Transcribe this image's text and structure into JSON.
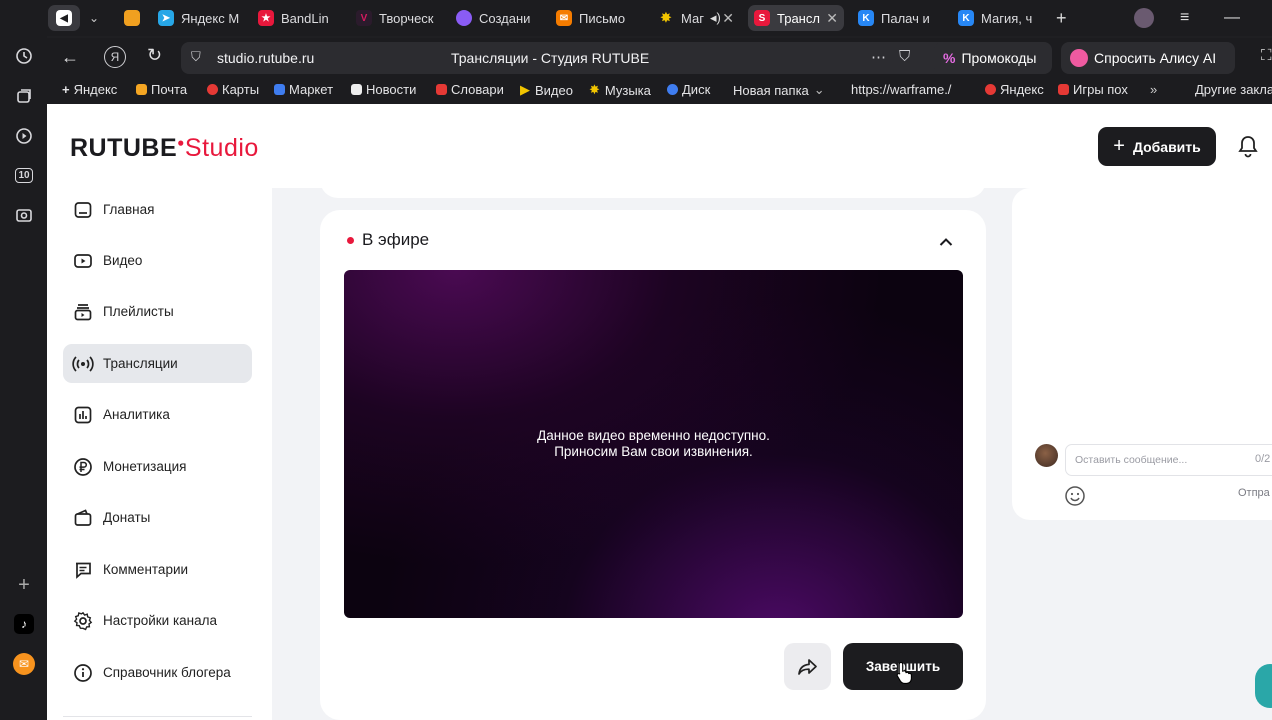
{
  "browser": {
    "tabs": [
      {
        "label": "",
        "icon": "yandex-browser-icon",
        "color": "#7a5cc8"
      },
      {
        "label": "",
        "icon": "tab-sound-icon",
        "color": "#ffffff"
      },
      {
        "label": "",
        "icon": "pinned-tab-icon",
        "color": "#f0a020"
      },
      {
        "label": "Яндекс М",
        "icon": "telegram-icon",
        "color": "#27a7e7"
      },
      {
        "label": "BandLin",
        "icon": "bandlink-icon",
        "color": "#e8183c"
      },
      {
        "label": "Творческ",
        "icon": "vk-studio-icon",
        "color": "#d81b60"
      },
      {
        "label": "Создани",
        "icon": "alice-icon",
        "color": "#8a5cf5"
      },
      {
        "label": "Письмо",
        "icon": "mail-icon",
        "color": "#f57c00"
      },
      {
        "label": "Маг",
        "icon": "star-icon",
        "color": "#f2c500"
      },
      {
        "label": "Трансл",
        "icon": "rutube-icon",
        "color": "#e8183c"
      },
      {
        "label": "Палач и",
        "icon": "vk-icon",
        "color": "#2787f5"
      },
      {
        "label": "Магия, ч",
        "icon": "vk-icon",
        "color": "#2787f5"
      }
    ],
    "url": "studio.rutube.ru",
    "page_title": "Трансляции - Студия RUTUBE",
    "promo_label": "Промокоды",
    "alice_label": "Спросить Алису AI",
    "bookmarks": [
      {
        "label": "Яндекс",
        "color": "#1c1c1f"
      },
      {
        "label": "Почта",
        "color": "#f5a623"
      },
      {
        "label": "Карты",
        "color": "#e53935"
      },
      {
        "label": "Маркет",
        "color": "#3f7df0"
      },
      {
        "label": "Новости",
        "color": "#eeeeee"
      },
      {
        "label": "Словари",
        "color": "#e53935"
      },
      {
        "label": "Видео",
        "color": "#f2c500"
      },
      {
        "label": "Музыка",
        "color": "#f2c500"
      },
      {
        "label": "Диск",
        "color": "#3f7df0"
      },
      {
        "label": "Новая папка",
        "color": ""
      },
      {
        "label": "https://warframe./",
        "color": ""
      },
      {
        "label": "Яндекс",
        "color": "#e53935"
      },
      {
        "label": "Игры пох",
        "color": "#e53935"
      },
      {
        "label": "Другие закла",
        "color": ""
      }
    ]
  },
  "header": {
    "logo_main": "RUTUBE",
    "logo_studio": "Studio",
    "add_button": "Добавить"
  },
  "sidebar": {
    "items": [
      {
        "label": "Главная",
        "icon": "home-icon"
      },
      {
        "label": "Видео",
        "icon": "video-icon"
      },
      {
        "label": "Плейлисты",
        "icon": "playlist-icon"
      },
      {
        "label": "Трансляции",
        "icon": "broadcast-icon",
        "active": true
      },
      {
        "label": "Аналитика",
        "icon": "analytics-icon"
      },
      {
        "label": "Монетизация",
        "icon": "ruble-icon"
      },
      {
        "label": "Донаты",
        "icon": "wallet-icon"
      },
      {
        "label": "Комментарии",
        "icon": "comments-icon"
      },
      {
        "label": "Настройки канала",
        "icon": "gear-icon"
      },
      {
        "label": "Справочник блогера",
        "icon": "info-icon"
      }
    ]
  },
  "live": {
    "status": "В эфире",
    "player_message_line1": "Данное видео временно недоступно.",
    "player_message_line2": "Приносим Вам свои извинения.",
    "end_button": "Завершить"
  },
  "chat": {
    "placeholder": "Оставить сообщение...",
    "counter": "0/2",
    "send_label": "Отпра"
  },
  "colors": {
    "accent": "#e8183c",
    "dark": "#1c1c1f",
    "page_bg": "#f2f3f6"
  }
}
